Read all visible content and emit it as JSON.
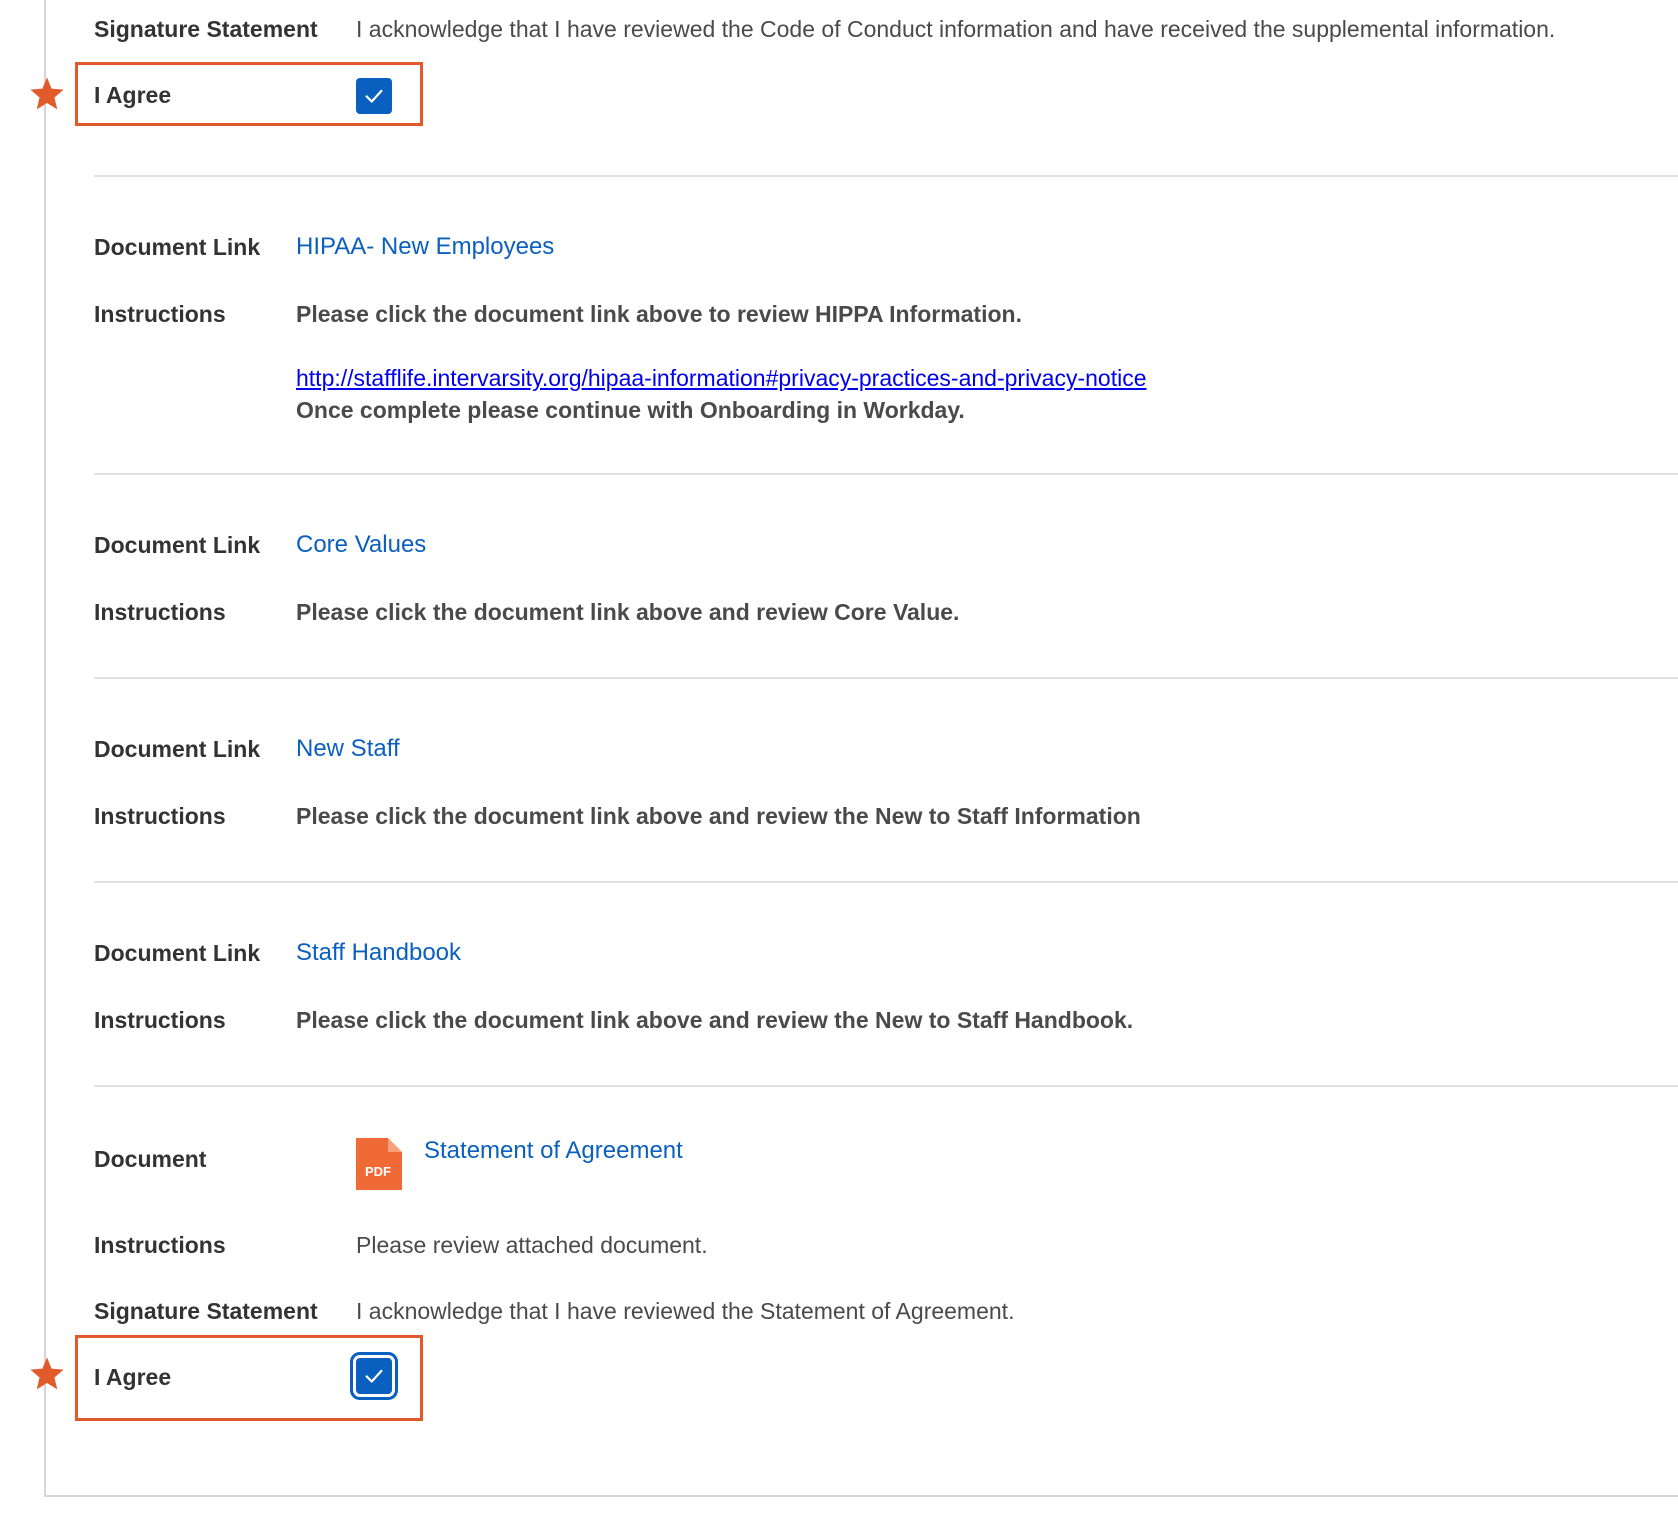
{
  "colors": {
    "accent": "#0b5fbf",
    "required": "#e05a2b",
    "pdf": "#f06a35"
  },
  "section1": {
    "signature_label": "Signature Statement",
    "signature_text": "I acknowledge that I have reviewed the Code of Conduct information and have received the supplemental information.",
    "agree_label": "I Agree",
    "agree_checked": true
  },
  "hipaa": {
    "doc_label": "Document Link",
    "doc_link": "HIPAA- New Employees",
    "instr_label": "Instructions",
    "instr_line1": "Please click the document link above to review HIPPA Information.",
    "url": "http://stafflife.intervarsity.org/hipaa-information#privacy-practices-and-privacy-notice",
    "instr_line2": "Once complete please continue with Onboarding in Workday."
  },
  "core_values": {
    "doc_label": "Document Link",
    "doc_link": "Core Values",
    "instr_label": "Instructions",
    "instr_text": "Please click the document link above and review Core Value."
  },
  "new_staff": {
    "doc_label": "Document Link",
    "doc_link": "New Staff",
    "instr_label": "Instructions",
    "instr_text": "Please click the document link above and review the New to Staff Information"
  },
  "handbook": {
    "doc_label": "Document Link",
    "doc_link": "Staff Handbook",
    "instr_label": "Instructions",
    "instr_text": "Please click the document link above and review the New to Staff Handbook."
  },
  "agreement": {
    "doc_label": "Document",
    "pdf_icon": "pdf-file-icon",
    "pdf_text": "PDF",
    "doc_link": "Statement of Agreement",
    "instr_label": "Instructions",
    "instr_text": "Please review attached document.",
    "signature_label": "Signature Statement",
    "signature_text": "I acknowledge that I have reviewed the Statement of Agreement.",
    "agree_label": "I Agree",
    "agree_checked": true
  }
}
